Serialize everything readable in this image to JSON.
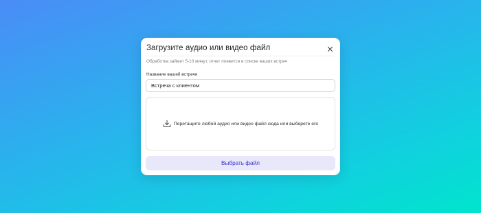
{
  "modal": {
    "title": "Загрузите аудио или видео файл",
    "subtitle": "Обработка займет 5-10 минут, отчет появится в списке ваших встреч",
    "close_icon": "close-icon",
    "name_field": {
      "label": "Название вашей встречи",
      "value": "Встреча с клиентом"
    },
    "dropzone": {
      "icon": "download-icon",
      "text": "Перетащите любой аудио или видео файл сюда или выберете его"
    },
    "choose_button_label": "Выбрать файл"
  },
  "colors": {
    "accent_text": "#3b34c7",
    "accent_bg": "#e9e8fb",
    "gradient_start": "#4a8cf7",
    "gradient_end": "#00e4cd"
  }
}
